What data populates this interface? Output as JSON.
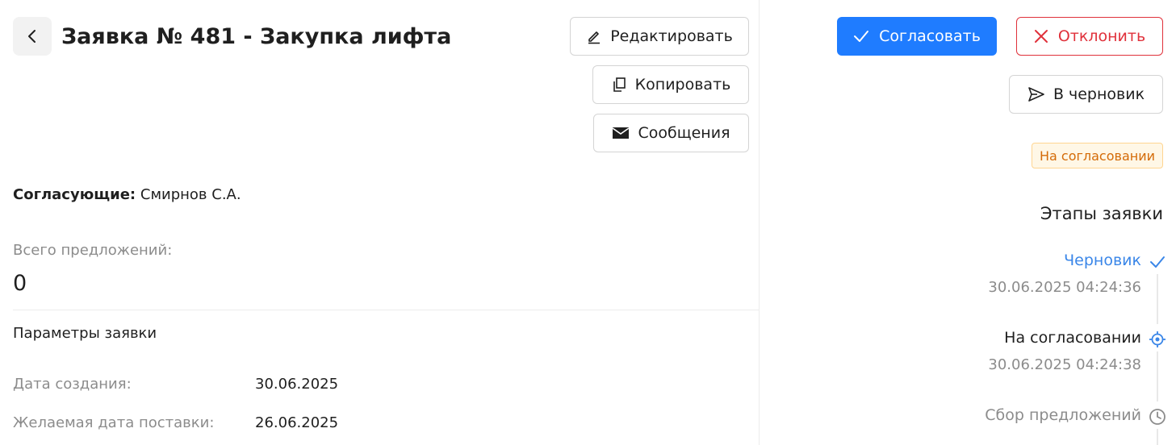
{
  "header": {
    "title": "Заявка № 481 - Закупка лифта"
  },
  "actions": {
    "edit_label": "Редактировать",
    "copy_label": "Копировать",
    "messages_label": "Сообщения",
    "approve_label": "Согласовать",
    "reject_label": "Отклонить",
    "draft_label": "В черновик"
  },
  "status": {
    "label": "На согласовании"
  },
  "approvers": {
    "label": "Согласующие:",
    "value": "Смирнов С.А."
  },
  "proposals": {
    "label": "Всего предложений:",
    "value": "0"
  },
  "params": {
    "title": "Параметры заявки",
    "rows": [
      {
        "label": "Дата создания:",
        "value": "30.06.2025"
      },
      {
        "label": "Желаемая дата поставки:",
        "value": "26.06.2025"
      }
    ]
  },
  "stages": {
    "title": "Этапы заявки",
    "items": [
      {
        "name": "Черновик",
        "date": "30.06.2025 04:24:36",
        "state": "done",
        "icon": "check-icon"
      },
      {
        "name": "На согласовании",
        "date": "30.06.2025 04:24:38",
        "state": "current",
        "icon": "target-icon"
      },
      {
        "name": "Сбор предложений",
        "date": "",
        "state": "pending",
        "icon": "clock-icon"
      }
    ]
  },
  "colors": {
    "primary": "#1f7cff",
    "danger": "#e0313b",
    "warning_bg": "#fff7e6",
    "warning_text": "#d46b08",
    "done_stage": "#3a86e8"
  }
}
